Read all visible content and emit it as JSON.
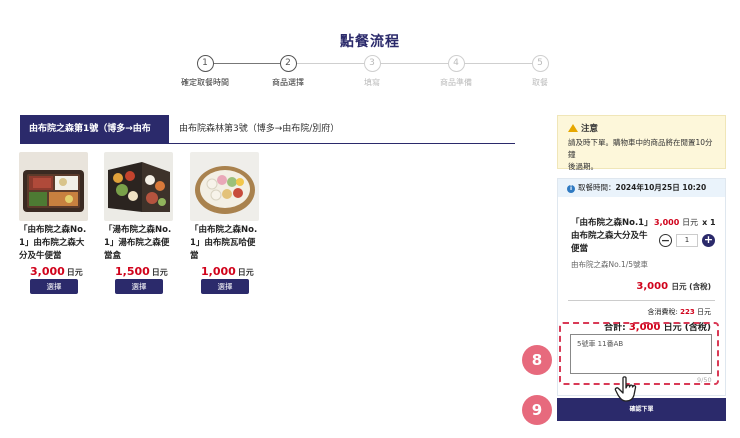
{
  "page": {
    "title": "點餐流程"
  },
  "steps": [
    {
      "num": "1",
      "label": "確定取餐時間",
      "state": "done"
    },
    {
      "num": "2",
      "label": "商品選擇",
      "state": "current"
    },
    {
      "num": "3",
      "label": "填寫",
      "state": "upcoming"
    },
    {
      "num": "4",
      "label": "商品準備",
      "state": "upcoming"
    },
    {
      "num": "5",
      "label": "取餐",
      "state": "upcoming"
    }
  ],
  "tabs": [
    {
      "label": "由布院之森第1號（博多→由布院）",
      "active": true
    },
    {
      "label": "由布院森林第3號（博多→由布院/別府）",
      "active": false
    }
  ],
  "products": [
    {
      "name_lines": [
        "「由布院之森No.",
        "1」由布院之森大",
        "分及牛便當"
      ],
      "price": "3,000",
      "unit": "日元",
      "button": "選擇"
    },
    {
      "name_lines": [
        "「湯布院之森No.",
        "1」湯布院之森便",
        "當盒"
      ],
      "price": "1,500",
      "unit": "日元",
      "button": "選擇"
    },
    {
      "name_lines": [
        "「由布院之森No.",
        "1」由布院瓦哈便",
        "當"
      ],
      "price": "1,000",
      "unit": "日元",
      "button": "選擇"
    }
  ],
  "notice": {
    "title": "注意",
    "text_lines": [
      "請及時下單。購物車中的商品將在閒置10分鐘",
      "後過期。"
    ]
  },
  "cart": {
    "pickup_label": "取餐時間：",
    "pickup_time": "2024年10月25日 10:20",
    "item": {
      "name_lines": [
        "「由布院之森No.1」",
        "由布院之森大分及牛",
        "便當"
      ],
      "price": "3,000",
      "unit": "日元",
      "qty_text": "x 1",
      "quantity": "1",
      "vehicle": "由布院之森No.1/5號車",
      "subtotal": "3,000",
      "subtotal_unit": "日元 (含稅)"
    },
    "tax_label": "含消費稅:",
    "tax_value": "223",
    "tax_unit": "日元",
    "total_label": "合計:",
    "total_value": "3,000",
    "total_unit": "日元 (含稅)"
  },
  "memo": {
    "value": "5號車 11番AB",
    "counter": "9/50"
  },
  "annotations": {
    "badge_8": "8",
    "badge_9": "9"
  },
  "submit": {
    "label": "確認下單"
  },
  "colors": {
    "brand": "#2b2a6b",
    "price": "#d0021b",
    "badge": "#e76a7d",
    "notice_bg": "#fdf7da"
  }
}
